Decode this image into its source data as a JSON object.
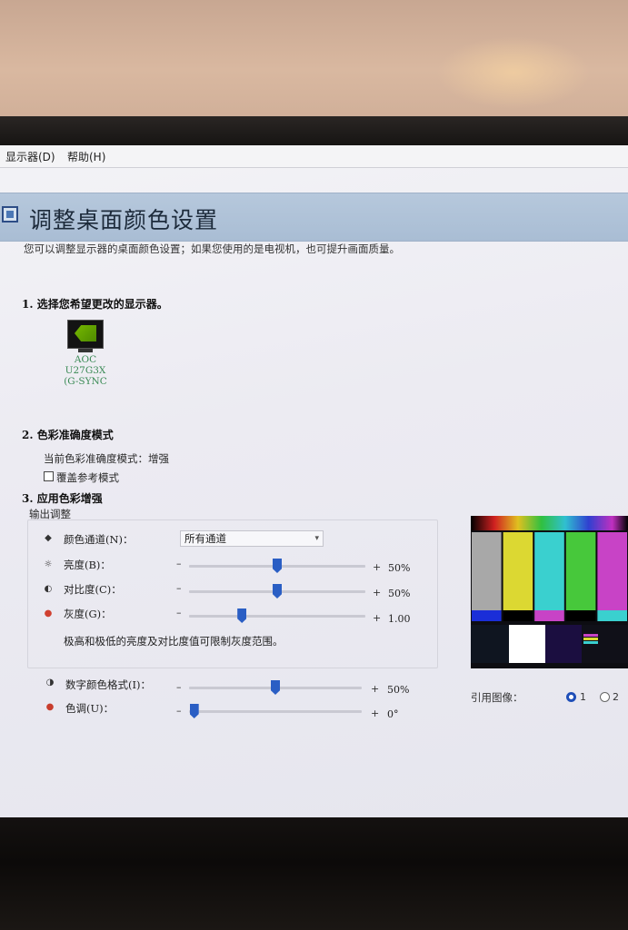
{
  "menubar": {
    "display": "显示器(D)",
    "help": "帮助(H)"
  },
  "header": {
    "title": "调整桌面颜色设置"
  },
  "description": "您可以调整显示器的桌面颜色设置；如果您使用的是电视机，也可提升画面质量。",
  "section1": {
    "heading": "1.  选择您希望更改的显示器。",
    "monitor_line1": "AOC U27G3X",
    "monitor_line2": "(G-SYNC"
  },
  "section2": {
    "heading": "2. 色彩准确度模式",
    "current_mode": "当前色彩准确度模式：增强",
    "override_label": "覆盖参考模式",
    "override_checked": false
  },
  "section3": {
    "heading": "3. 应用色彩增强",
    "group_label": "输出调整",
    "channel": {
      "label": "颜色通道(N)：",
      "selected": "所有通道"
    },
    "brightness": {
      "label": "亮度(B)：",
      "value_text": "50%",
      "level": 0.5
    },
    "contrast": {
      "label": "对比度(C)：",
      "value_text": "50%",
      "level": 0.5
    },
    "gamma": {
      "label": "灰度(G)：",
      "value_text": "1.00",
      "level": 0.3
    },
    "note": "极高和极低的亮度及对比度值可限制灰度范围。",
    "digital_vibrance": {
      "label": "数字颜色格式(I)：",
      "value_text": "50%",
      "level": 0.5
    },
    "hue": {
      "label": "色调(U)：",
      "value_text": "0°",
      "level": 0.03
    },
    "minus": "–",
    "plus": "+"
  },
  "reference": {
    "label": "引用图像：",
    "option1": "1",
    "option2": "2",
    "selected": 1
  },
  "colors": {
    "title_bar": "#a9bdd4",
    "slider_thumb": "#2a5ec4",
    "monitor_label": "#3a8a55",
    "bars": [
      "#a8a8a8",
      "#dcd832",
      "#3ad0cf",
      "#47c83b",
      "#c843c6"
    ],
    "bottom_bars": [
      "#1b2ed8",
      "#000000",
      "#c843c6",
      "#000000",
      "#3ad0cf"
    ]
  }
}
